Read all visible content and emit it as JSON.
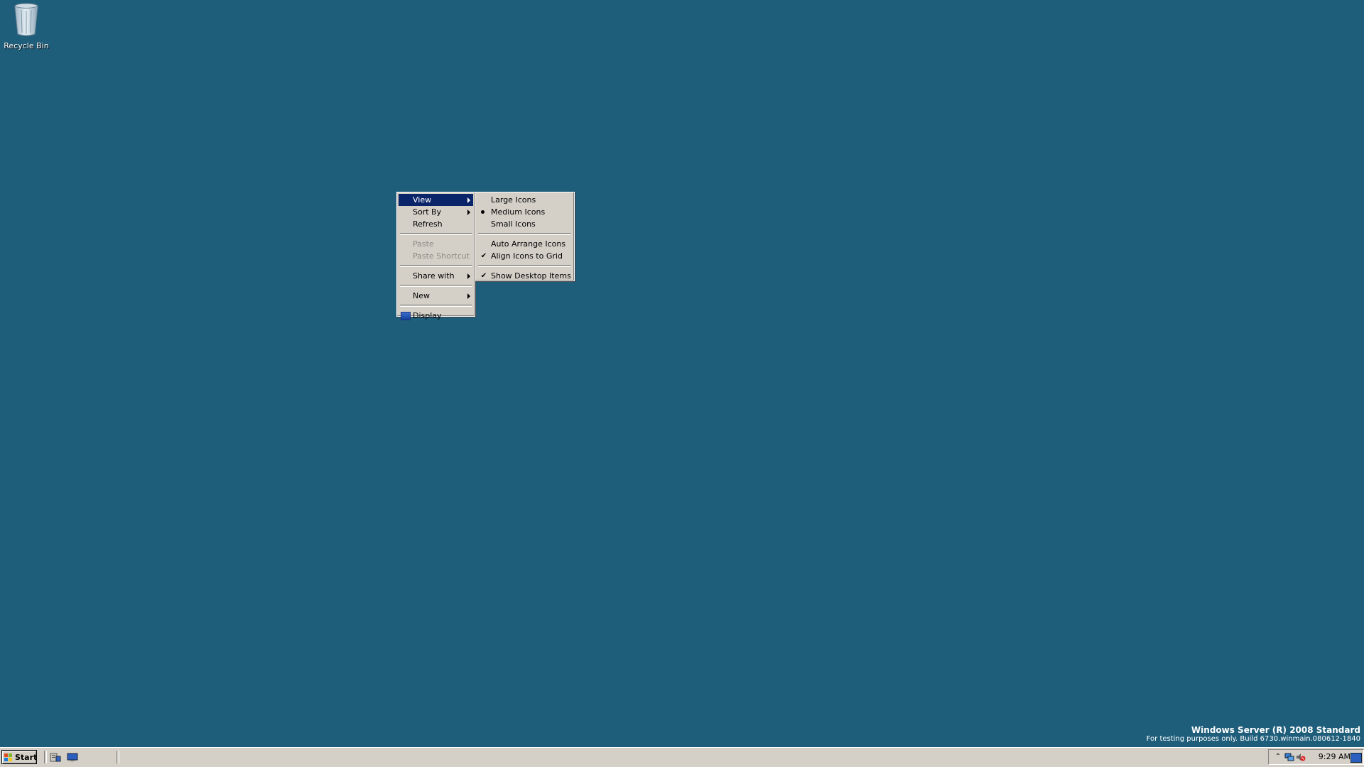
{
  "desktop": {
    "background": "#1f5e7b",
    "icons": [
      {
        "label": "Recycle Bin",
        "icon": "recycle-bin-icon"
      }
    ]
  },
  "context_menu": {
    "items": {
      "view": "View",
      "sort_by": "Sort By",
      "refresh": "Refresh",
      "paste": "Paste",
      "paste_shortcut": "Paste Shortcut",
      "share_with": "Share with",
      "new": "New",
      "display": "Display"
    },
    "highlighted": "View"
  },
  "view_submenu": {
    "items": {
      "large_icons": "Large Icons",
      "medium_icons": "Medium Icons",
      "small_icons": "Small Icons",
      "auto_arrange": "Auto Arrange Icons",
      "align_to_grid": "Align Icons to Grid",
      "show_desktop_items": "Show Desktop Items"
    },
    "selected_size": "Medium Icons",
    "checked": [
      "Align Icons to Grid",
      "Show Desktop Items"
    ]
  },
  "watermark": {
    "line1": "Windows Server (R) 2008 Standard",
    "line2": "For testing purposes only. Build 6730.winmain.080612-1840"
  },
  "taskbar": {
    "start_label": "Start",
    "clock": "9:29 AM",
    "highlight_color": "#0a246a"
  }
}
